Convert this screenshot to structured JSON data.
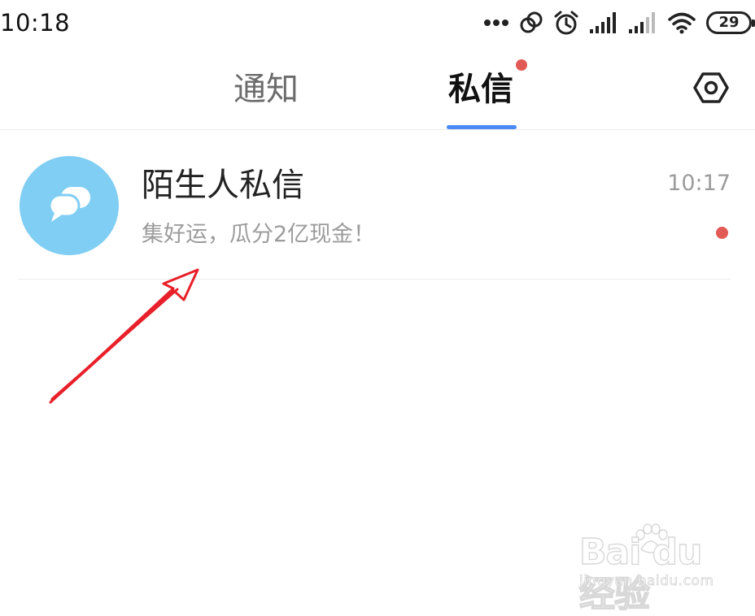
{
  "status_bar": {
    "time": "10:18",
    "battery_level": "29",
    "icons": [
      "more-dots-icon",
      "link-icon",
      "alarm-icon",
      "signal-icon",
      "signal-icon",
      "wifi-icon",
      "battery-icon"
    ]
  },
  "tabs": [
    {
      "label": "通知",
      "active": false
    },
    {
      "label": "私信",
      "active": true,
      "has_dot": true
    }
  ],
  "header": {
    "settings_icon": "settings-hexagon-icon"
  },
  "conversations": [
    {
      "title": "陌生人私信",
      "preview": "集好运，瓜分2亿现金！",
      "time": "10:17",
      "unread": true,
      "avatar_icon": "chat-bubbles-icon"
    }
  ],
  "watermark": {
    "logo_text": "Bai du 经验",
    "url": "jingyan.baidu.com"
  },
  "colors": {
    "accent": "#4a8af4",
    "badge": "#e25a56",
    "avatar_bg": "#80cef3",
    "muted_text": "#9c9c9c",
    "annotation_arrow": "#e8202a"
  }
}
